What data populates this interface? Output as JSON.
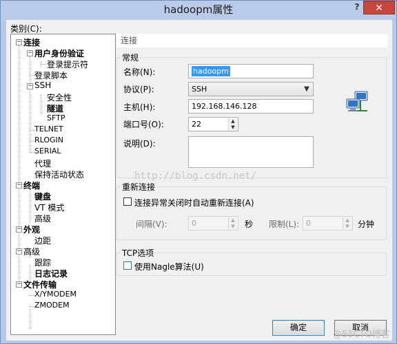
{
  "window": {
    "title": "hadoopm属性",
    "help": "?",
    "close": "✕"
  },
  "category_label": "类别(C):",
  "tree": [
    {
      "label": "连接",
      "bold": true
    },
    {
      "label": "用户身份验证",
      "bold": true
    },
    {
      "label": "登录提示符",
      "bold": false
    },
    {
      "label": "登录脚本",
      "bold": false
    },
    {
      "label": "SSH",
      "bold": false
    },
    {
      "label": "安全性",
      "bold": false
    },
    {
      "label": "隧道",
      "bold": true
    },
    {
      "label": "SFTP",
      "bold": false
    },
    {
      "label": "TELNET",
      "bold": false
    },
    {
      "label": "RLOGIN",
      "bold": false
    },
    {
      "label": "SERIAL",
      "bold": false
    },
    {
      "label": "代理",
      "bold": false
    },
    {
      "label": "保持活动状态",
      "bold": false
    },
    {
      "label": "终端",
      "bold": true
    },
    {
      "label": "键盘",
      "bold": true
    },
    {
      "label": "VT 模式",
      "bold": false
    },
    {
      "label": "高级",
      "bold": false
    },
    {
      "label": "外观",
      "bold": true
    },
    {
      "label": "边距",
      "bold": false
    },
    {
      "label": "高级",
      "bold": false
    },
    {
      "label": "跟踪",
      "bold": false
    },
    {
      "label": "日志记录",
      "bold": true
    },
    {
      "label": "文件传输",
      "bold": true
    },
    {
      "label": "X/YMODEM",
      "bold": false
    },
    {
      "label": "ZMODEM",
      "bold": false
    }
  ],
  "panel": {
    "header": "连接",
    "general": {
      "title": "常规",
      "name_label": "名称(N):",
      "name_value": "hadoopm",
      "protocol_label": "协议(P):",
      "protocol_value": "SSH",
      "host_label": "主机(H):",
      "host_value": "192.168.146.128",
      "port_label": "端口号(O):",
      "port_value": "22",
      "desc_label": "说明(D):",
      "desc_value": ""
    },
    "reconnect": {
      "title": "重新连接",
      "auto_label": "连接异常关闭时自动重新连接(A)",
      "interval_label": "间隔(V):",
      "interval_value": "0",
      "seconds": "秒",
      "limit_label": "限制(L):",
      "limit_value": "0",
      "minutes": "分钟"
    },
    "tcp": {
      "title": "TCP选项",
      "nagle_label": "使用Nagle算法(U)"
    }
  },
  "buttons": {
    "ok": "确定",
    "cancel": "取消"
  },
  "watermark": "http://blog.csdn.net/",
  "watermark2": "@51CTO博客",
  "icons": {
    "network": "network-computers-icon"
  }
}
